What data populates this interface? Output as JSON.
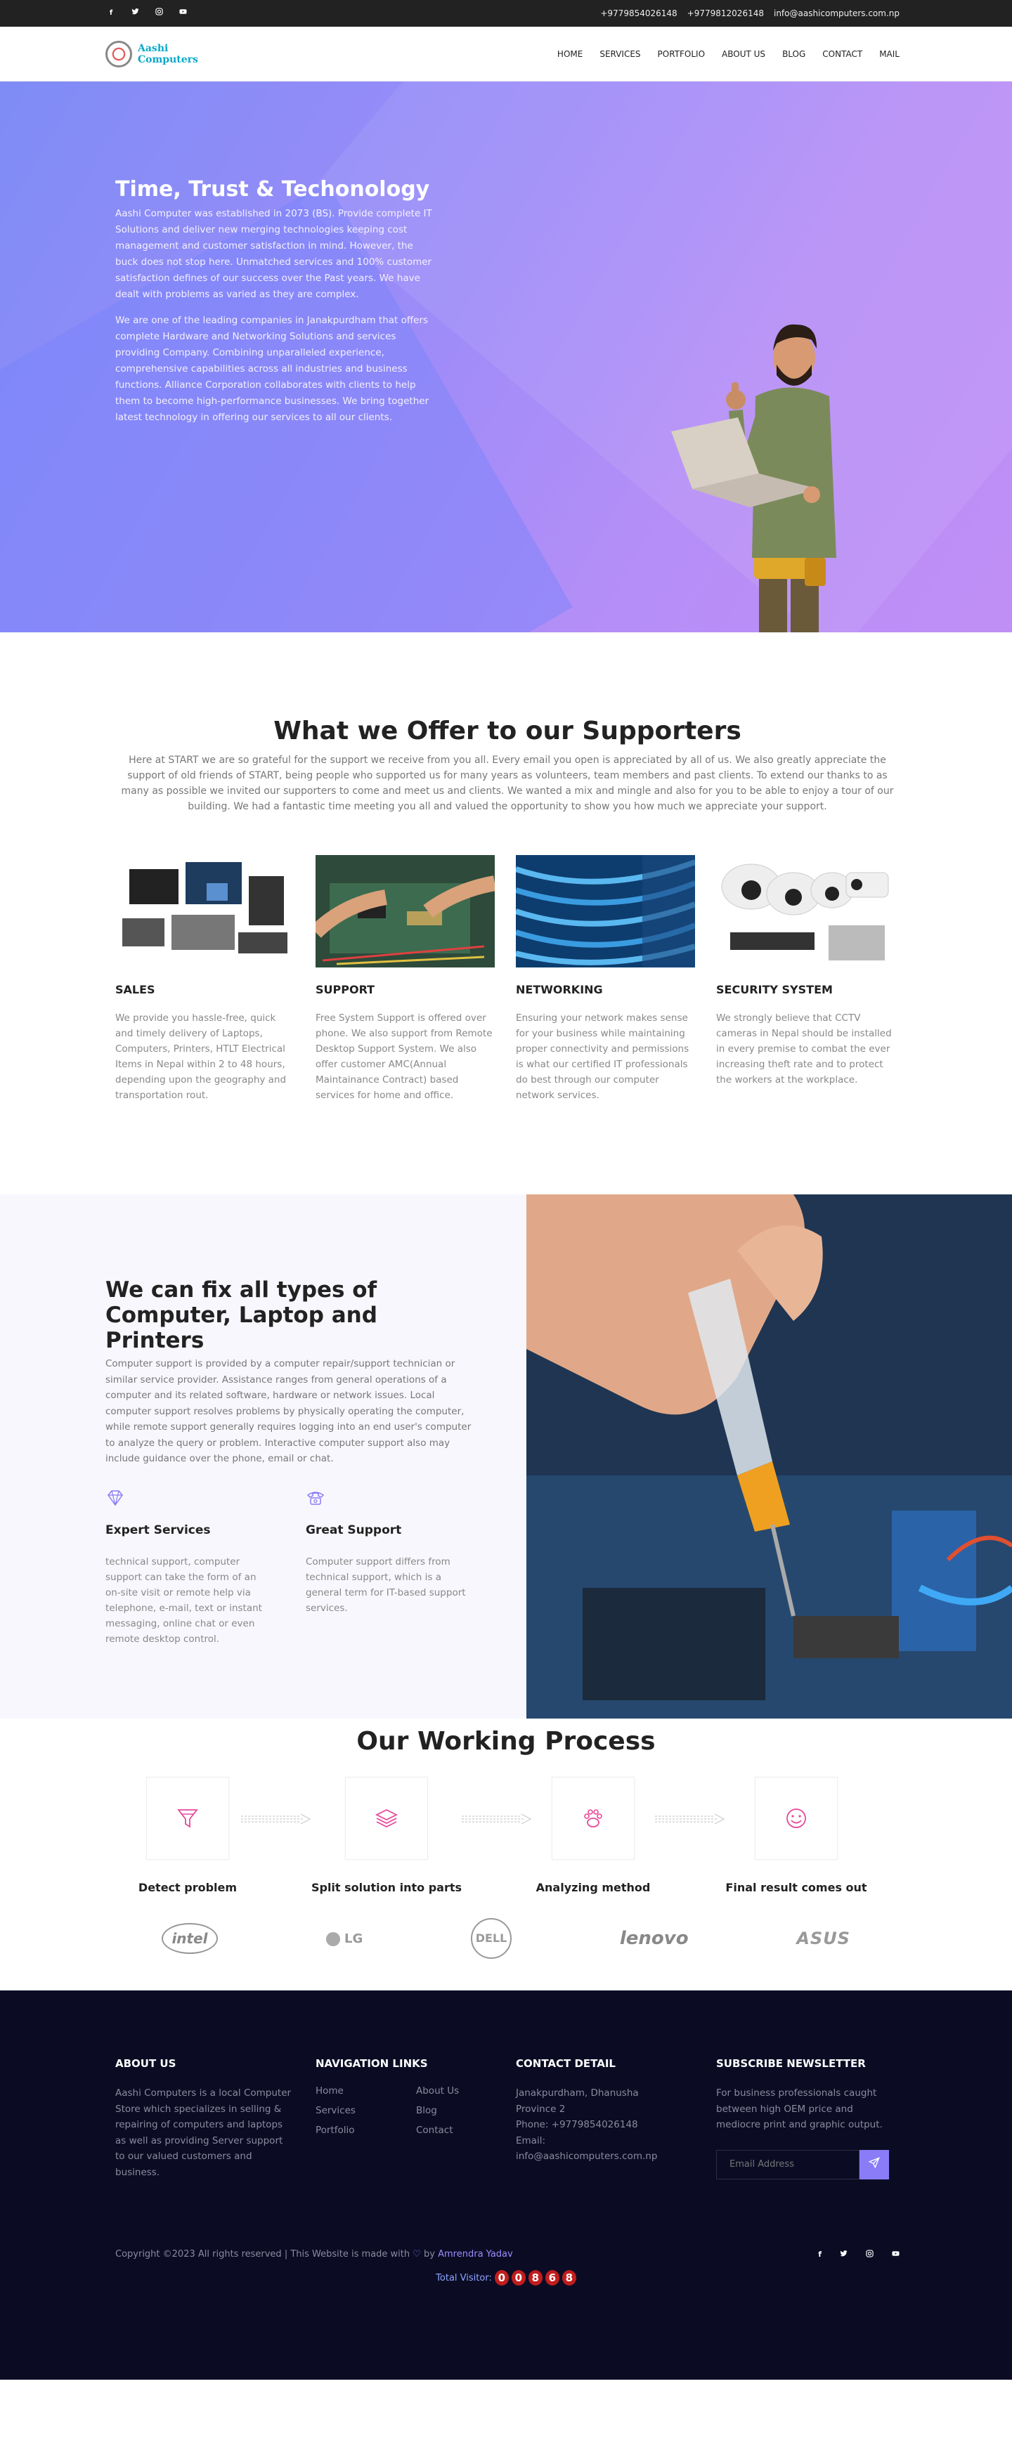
{
  "topbar": {
    "phone1": "+9779854026148",
    "phone2": "+9779812026148",
    "email": "info@aashicomputers.com.np",
    "socials": [
      "facebook-icon",
      "twitter-icon",
      "instagram-icon",
      "youtube-icon"
    ]
  },
  "header": {
    "logo_line1": "Aashi",
    "logo_line2": "Computers",
    "nav": [
      "HOME",
      "SERVICES",
      "PORTFOLIO",
      "ABOUT US",
      "BLOG",
      "CONTACT",
      "MAIL"
    ]
  },
  "hero": {
    "title": "Time, Trust & Techonology",
    "para1": "Aashi Computer was established in 2073 (BS). Provide complete IT Solutions and deliver new merging technologies keeping cost management and customer satisfaction in mind. However, the buck does not stop here. Unmatched services and 100% customer satisfaction defines of our success over the Past years. We have dealt with problems as varied as they are complex.",
    "para2": "We are one of the leading companies in Janakpurdham that offers complete Hardware and Networking Solutions and services providing Company. Combining unparalleled experience, comprehensive capabilities across all industries and business functions. Alliance Corporation collaborates with clients to help them to become high-performance businesses. We bring together latest technology in offering our services to all our clients."
  },
  "offer": {
    "title": "What we Offer to our Supporters",
    "lead": "Here at START we are so grateful for the support we receive from you all. Every email you open is appreciated by all of us. We also greatly appreciate the support of old friends of START, being people who supported us for many years as volunteers, team members and past clients. To extend our thanks to as many as possible we invited our supporters to come and meet us and clients. We wanted a mix and mingle and also for you to be able to enjoy a tour of our building. We had a fantastic time meeting you all and valued the opportunity to show you how much we appreciate your support.",
    "cards": [
      {
        "title": "SALES",
        "text": "We provide you hassle-free, quick and timely delivery of Laptops, Computers, Printers, HTLT Electrical Items in Nepal within 2 to 48 hours, depending upon the geography and transportation rout."
      },
      {
        "title": "SUPPORT",
        "text": "Free System Support is offered over phone. We also support from Remote Desktop Support System. We also offer customer AMC(Annual Maintainance Contract) based services for home and office."
      },
      {
        "title": "NETWORKING",
        "text": "Ensuring your network makes sense for your business while maintaining proper connectivity and permissions is what our certified IT professionals do best through our computer network services."
      },
      {
        "title": "SECURITY SYSTEM",
        "text": "We strongly believe that CCTV cameras in Nepal should be installed in every premise to combat the ever increasing theft rate and to protect the workers at the workplace."
      }
    ]
  },
  "fix": {
    "title_line1": "We can fix all types of",
    "title_line2": "Computer, Laptop and Printers",
    "desc": "Computer support is provided by a computer repair/support technician or similar service provider. Assistance ranges from general operations of a computer and its related software, hardware or network issues. Local computer support resolves problems by physically operating the computer, while remote support generally requires logging into an end user's computer to analyze the query or problem. Interactive computer support also may include guidance over the phone, email or chat.",
    "features": [
      {
        "icon": "diamond-icon",
        "title": "Expert Services",
        "text": "technical support, computer support can take the form of an on-site visit or remote help via telephone, e-mail, text or instant messaging, online chat or even remote desktop control."
      },
      {
        "icon": "telephone-icon",
        "title": "Great Support",
        "text": "Computer support differs from technical support, which is a general term for IT-based support services."
      }
    ]
  },
  "process": {
    "title": "Our Working Process",
    "steps": [
      {
        "icon": "funnel-icon",
        "label": "Detect problem"
      },
      {
        "icon": "layers-icon",
        "label": "Split solution into parts"
      },
      {
        "icon": "paw-icon",
        "label": "Analyzing method"
      },
      {
        "icon": "smile-icon",
        "label": "Final result comes out"
      }
    ],
    "brands": [
      "intel",
      "LG",
      "DELL",
      "lenovo",
      "ASUS"
    ]
  },
  "footer": {
    "about_title": "ABOUT US",
    "about_text": "Aashi Computers is a local Computer Store which specializes in selling & repairing of computers and laptops as well as providing Server support to our valued customers and business.",
    "nav_title": "NAVIGATION LINKS",
    "nav_links": [
      "Home",
      "About Us",
      "Services",
      "Blog",
      "Portfolio",
      "Contact"
    ],
    "contact_title": "CONTACT DETAIL",
    "contact_address": "Janakpurdham, Dhanusha",
    "contact_province": "Province 2",
    "contact_phone": "Phone: +9779854026148",
    "contact_email_label": "Email:",
    "contact_email": "info@aashicomputers.com.np",
    "subscribe_title": "SUBSCRIBE NEWSLETTER",
    "subscribe_text": "For business professionals caught between high OEM price and mediocre print and graphic output.",
    "email_placeholder": "Email Address",
    "copyright_prefix": "Copyright ©2023 All rights reserved | This Website is made with",
    "copyright_by": "by",
    "author": "Amrendra Yadav",
    "visitor_label": "Total Visitor:",
    "visitor_digits": [
      "0",
      "0",
      "8",
      "6",
      "8"
    ]
  },
  "colors": {
    "accent": "#8a7cf6",
    "footer_bg": "#0b0c24",
    "topbar_bg": "#222222",
    "icon_pink": "#e8489a"
  }
}
